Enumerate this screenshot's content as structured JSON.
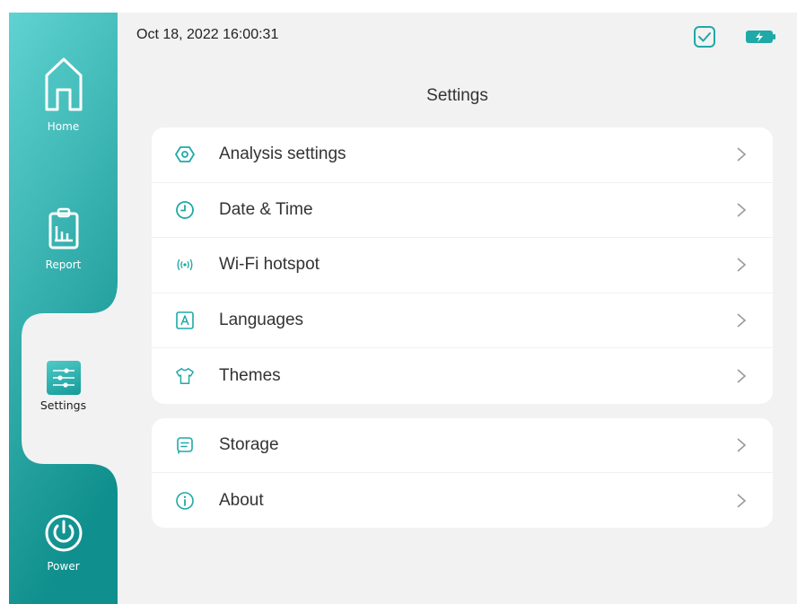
{
  "sidebar": {
    "items": [
      {
        "label": "Home",
        "icon": "home-icon"
      },
      {
        "label": "Report",
        "icon": "report-icon"
      },
      {
        "label": "Settings",
        "icon": "sliders-icon",
        "active": true
      },
      {
        "label": "Power",
        "icon": "power-icon"
      }
    ]
  },
  "status": {
    "datetime": "Oct 18, 2022 16:00:31",
    "icons": [
      "check-icon",
      "battery-charging-icon"
    ]
  },
  "page": {
    "title": "Settings"
  },
  "menu": {
    "group1": [
      {
        "label": "Analysis settings",
        "icon": "hexagon-icon"
      },
      {
        "label": "Date & Time",
        "icon": "clock-icon"
      },
      {
        "label": "Wi-Fi hotspot",
        "icon": "wifi-hotspot-icon"
      },
      {
        "label": "Languages",
        "icon": "language-icon"
      },
      {
        "label": "Themes",
        "icon": "shirt-icon"
      }
    ],
    "group2": [
      {
        "label": "Storage",
        "icon": "storage-icon"
      },
      {
        "label": "About",
        "icon": "info-icon"
      }
    ]
  },
  "colors": {
    "accent": "#1fa9a7",
    "sidebar_top": "#5fd3d1",
    "sidebar_bottom": "#0f8f8d",
    "background": "#f2f2f2"
  }
}
